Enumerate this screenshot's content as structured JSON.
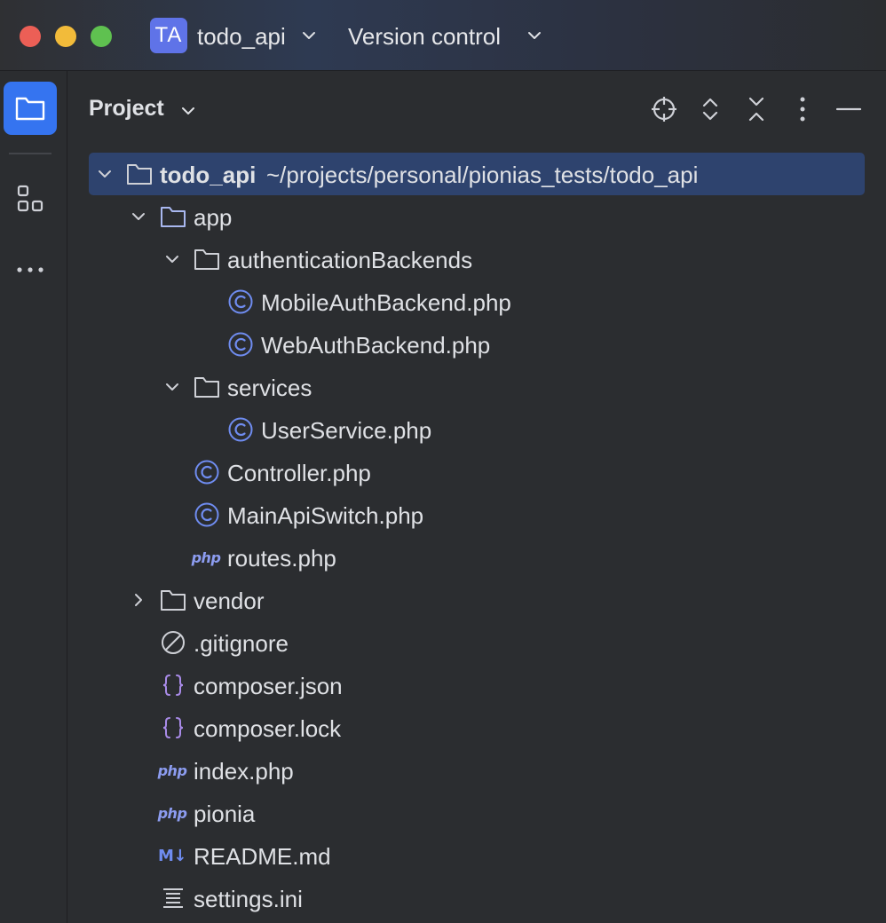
{
  "titlebar": {
    "project_badge": "TA",
    "project_name": "todo_api",
    "vcs_label": "Version control"
  },
  "toolstrip": {
    "items": [
      {
        "icon": "folder-icon",
        "active": true
      },
      {
        "icon": "structure-icon",
        "active": false
      },
      {
        "icon": "more-horizontal-icon",
        "active": false
      }
    ]
  },
  "panel": {
    "title": "Project",
    "header_icons": [
      "locate-icon",
      "expand-all-icon",
      "collapse-all-icon",
      "more-vertical-icon",
      "hide-icon"
    ]
  },
  "tree": [
    {
      "label": "todo_api",
      "path": "~/projects/personal/pionias_tests/todo_api",
      "type": "folder",
      "icon": "folder-icon",
      "expanded": true,
      "selected": true,
      "depth": 0
    },
    {
      "label": "app",
      "type": "folder",
      "icon": "folder-icon",
      "expanded": true,
      "depth": 1,
      "accent": true
    },
    {
      "label": "authenticationBackends",
      "type": "folder",
      "icon": "folder-icon",
      "expanded": true,
      "depth": 2
    },
    {
      "label": "MobileAuthBackend.php",
      "type": "class",
      "icon": "php-class-icon",
      "depth": 3
    },
    {
      "label": "WebAuthBackend.php",
      "type": "class",
      "icon": "php-class-icon",
      "depth": 3
    },
    {
      "label": "services",
      "type": "folder",
      "icon": "folder-icon",
      "expanded": true,
      "depth": 2
    },
    {
      "label": "UserService.php",
      "type": "class",
      "icon": "php-class-icon",
      "depth": 3
    },
    {
      "label": "Controller.php",
      "type": "class",
      "icon": "php-class-icon",
      "depth": 2
    },
    {
      "label": "MainApiSwitch.php",
      "type": "class",
      "icon": "php-class-icon",
      "depth": 2
    },
    {
      "label": "routes.php",
      "type": "php",
      "icon": "php-file-icon",
      "icon_text": "php",
      "depth": 2
    },
    {
      "label": "vendor",
      "type": "folder",
      "icon": "folder-icon",
      "expanded": false,
      "depth": 1
    },
    {
      "label": ".gitignore",
      "type": "ignore",
      "icon": "ignore-file-icon",
      "depth": 1
    },
    {
      "label": "composer.json",
      "type": "json",
      "icon": "json-braces-icon",
      "depth": 1
    },
    {
      "label": "composer.lock",
      "type": "json",
      "icon": "json-braces-icon",
      "depth": 1
    },
    {
      "label": "index.php",
      "type": "php",
      "icon": "php-file-icon",
      "icon_text": "php",
      "depth": 1
    },
    {
      "label": "pionia",
      "type": "php",
      "icon": "php-file-icon",
      "icon_text": "php",
      "depth": 1
    },
    {
      "label": "README.md",
      "type": "markdown",
      "icon": "markdown-icon",
      "icon_text": "M↓",
      "depth": 1
    },
    {
      "label": "settings.ini",
      "type": "text",
      "icon": "text-file-icon",
      "depth": 1
    }
  ],
  "colors": {
    "background": "#2b2d30",
    "selection": "#2e436e",
    "accent": "#3574f0",
    "badge": "#5f73e8",
    "class_icon": "#6f8cf0",
    "json_icon": "#a98be8"
  }
}
